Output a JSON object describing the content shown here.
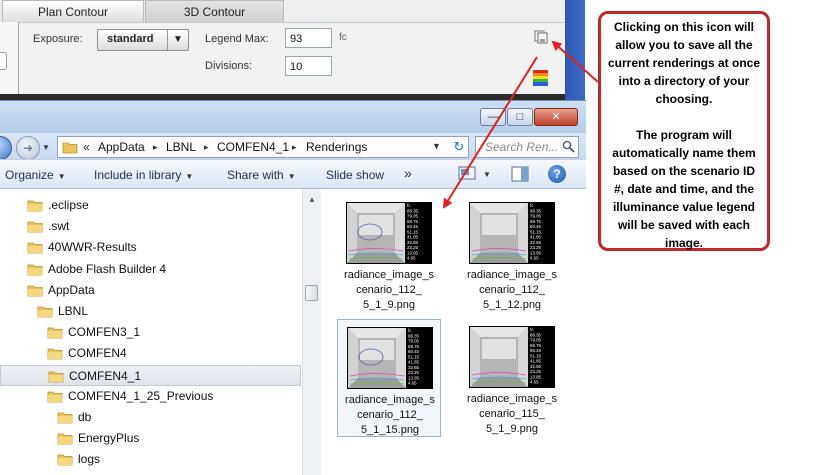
{
  "app": {
    "tabs": [
      {
        "label": "Plan Contour",
        "active": true
      },
      {
        "label": "3D Contour",
        "active": false
      }
    ],
    "exposure": {
      "label": "Exposure:",
      "value": "standard"
    },
    "legend_max": {
      "label": "Legend Max:",
      "value": "93",
      "unit": "fc"
    },
    "divisions": {
      "label": "Divisions:",
      "value": "10"
    },
    "icons": {
      "save_all": "save-all-renderings-icon",
      "legend_colors": "color-legend-icon"
    }
  },
  "explorer": {
    "title_buttons": {
      "minimize": "—",
      "maximize": "□",
      "close": "✕"
    },
    "address": {
      "overflow": "«",
      "crumbs": [
        "AppData",
        "LBNL",
        "COMFEN4_1",
        "Renderings"
      ]
    },
    "search": {
      "placeholder": "Search Ren..."
    },
    "toolbar": {
      "organize": "Organize",
      "include_in_library": "Include in library",
      "share_with": "Share with",
      "slide_show": "Slide show",
      "more": "»",
      "help": "?"
    },
    "tree": [
      {
        "label": ".eclipse",
        "level": 0
      },
      {
        "label": ".swt",
        "level": 0
      },
      {
        "label": "40WWR-Results",
        "level": 0
      },
      {
        "label": "Adobe Flash Builder 4",
        "level": 0
      },
      {
        "label": "AppData",
        "level": 0
      },
      {
        "label": "LBNL",
        "level": 1
      },
      {
        "label": "COMFEN3_1",
        "level": 2
      },
      {
        "label": "COMFEN4",
        "level": 2
      },
      {
        "label": "COMFEN4_1",
        "level": 2,
        "selected": true
      },
      {
        "label": "COMFEN4_1_25_Previous",
        "level": 2
      },
      {
        "label": "db",
        "level": 3
      },
      {
        "label": "EnergyPlus",
        "level": 3
      },
      {
        "label": "logs",
        "level": 3
      }
    ],
    "files": [
      {
        "line1": "radiance_image_s",
        "line2": "cenario_112_",
        "line3": "5_1_9.png",
        "selected": false
      },
      {
        "line1": "radiance_image_s",
        "line2": "cenario_112_",
        "line3": "5_1_12.png",
        "selected": false
      },
      {
        "line1": "radiance_image_s",
        "line2": "cenario_112_",
        "line3": "5_1_15.png",
        "selected": true
      },
      {
        "line1": "radiance_image_s",
        "line2": "cenario_115_",
        "line3": "5_1_9.png",
        "selected": false
      }
    ],
    "legend_values": [
      "fc",
      "88.35",
      "79.05",
      "69.75",
      "60.45",
      "51.15",
      "41.85",
      "32.55",
      "23.25",
      "13.95",
      "4.65"
    ]
  },
  "callout": {
    "paragraph1": "Clicking on this icon will allow you to save all the current renderings at once into a directory of your choosing.",
    "paragraph2": "The program will automatically name them based on the scenario ID #, date and time, and the illuminance value legend will be saved with each image."
  },
  "colors": {
    "callout_border": "#c1272d",
    "arrow": "#e02020",
    "folder": "#e8c45a"
  }
}
